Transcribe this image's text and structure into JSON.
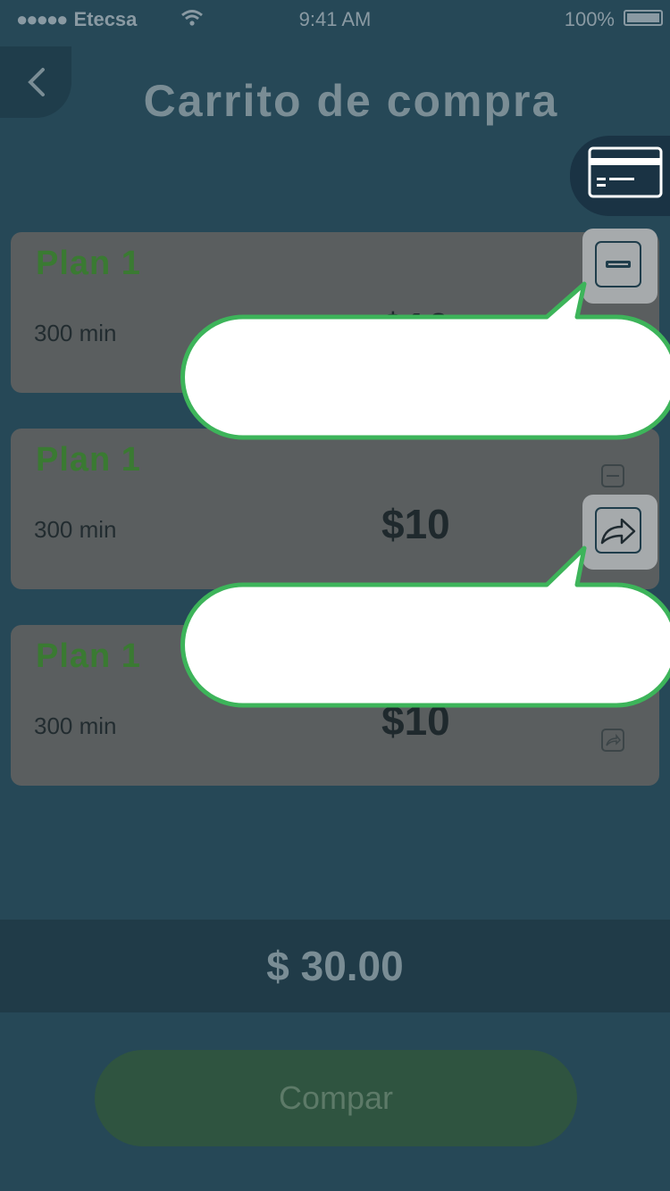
{
  "status_bar": {
    "carrier": "Etecsa",
    "time": "9:41 AM",
    "battery": "100%"
  },
  "header": {
    "title": "Carrito de compra"
  },
  "cart": {
    "items": [
      {
        "name": "Plan 1",
        "minutes": "300 min",
        "price": "$10"
      },
      {
        "name": "Plan 1",
        "minutes": "300 min",
        "price": "$10"
      },
      {
        "name": "Plan 1",
        "minutes": "300 min",
        "price": "$10"
      }
    ]
  },
  "summary": {
    "total": "$ 30.00"
  },
  "actions": {
    "buy_label": "Compar"
  },
  "colors": {
    "background": "#264857",
    "accent_green": "#3db45a",
    "card": "#5a5e5f"
  }
}
